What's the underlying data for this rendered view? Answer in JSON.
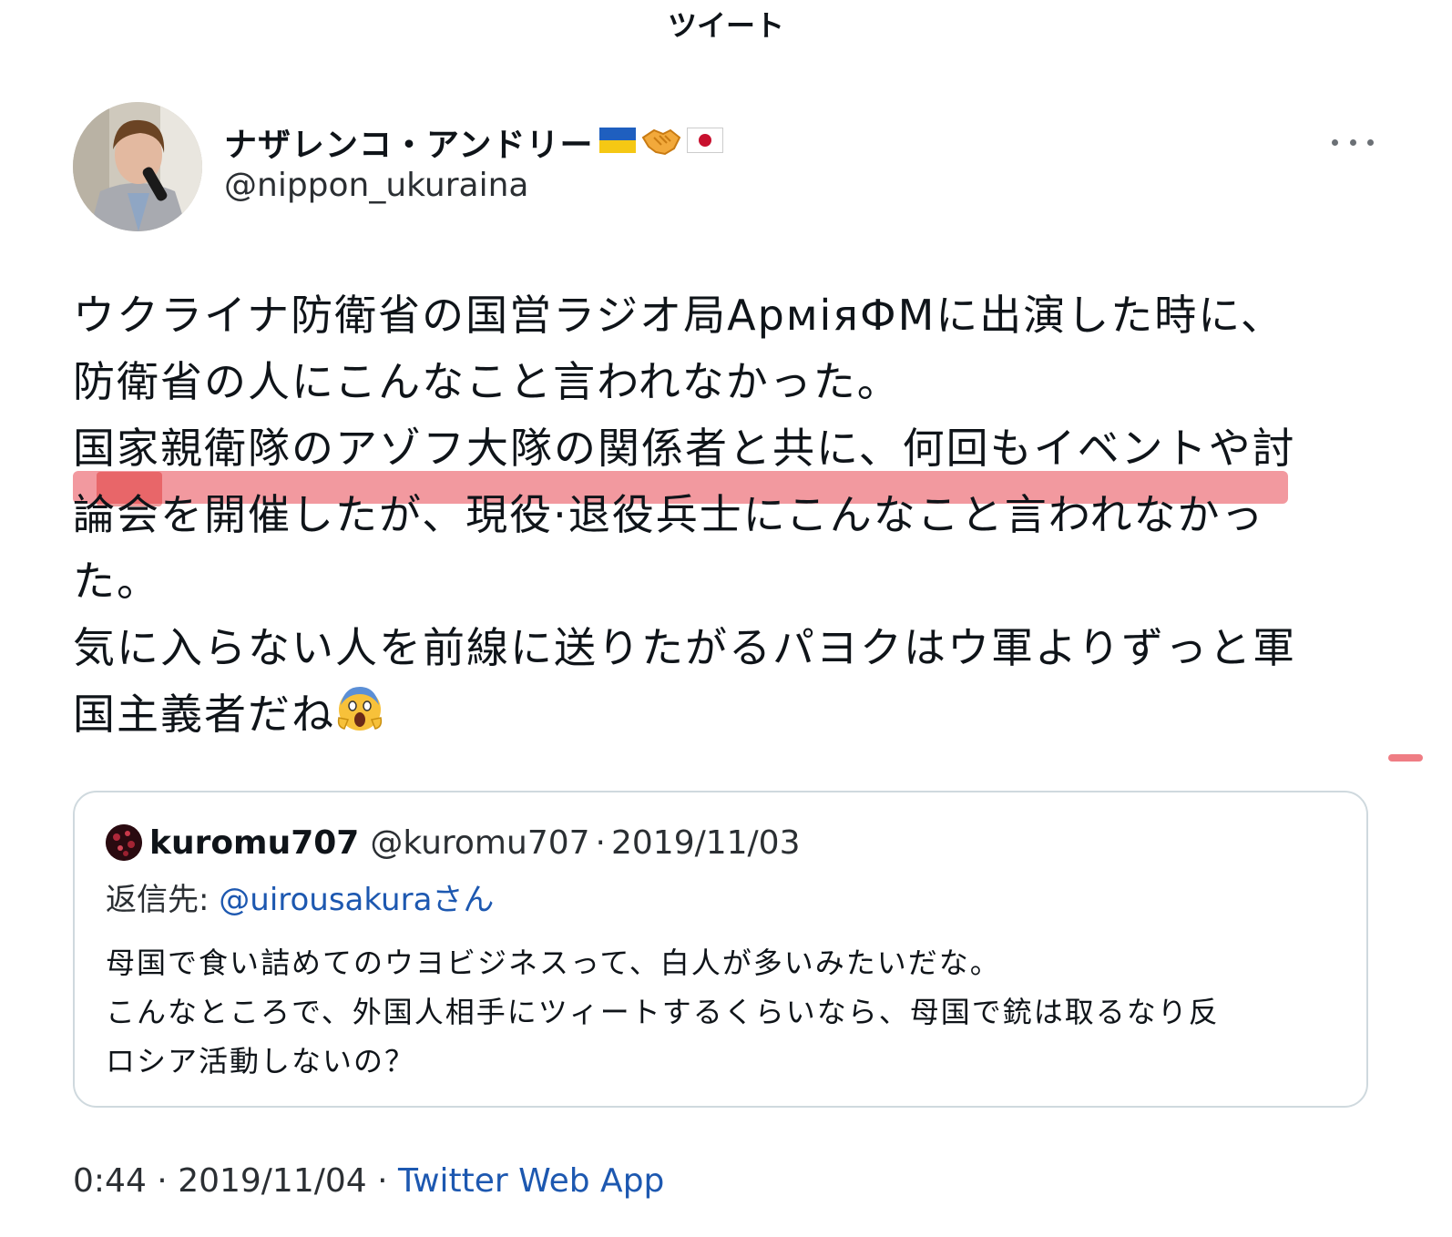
{
  "header": {
    "title": "ツイート"
  },
  "author": {
    "name": "ナザレンコ・アンドリー",
    "handle": "@nippon_ukuraina",
    "name_icons": [
      "ukraine-flag-icon",
      "handshake-icon",
      "japan-flag-icon"
    ]
  },
  "tweet": {
    "lines": [
      "ウクライナ防衛省の国営ラジオ局АрміяФМに出演した時に、",
      "防衛省の人にこんなこと言われなかった。",
      "国家親衛隊のアゾフ大隊の関係者と共に、何回もイベントや討",
      "論会を開催したが、現役·退役兵士にこんなこと言われなかっ",
      "た。",
      "気に入らない人を前線に送りたがるパヨクはウ軍よりずっと軍",
      "国主義者だね"
    ],
    "trailing_emoji": "screaming-face-icon"
  },
  "quote": {
    "name": "kuromu707",
    "handle": "@kuromu707",
    "separator": "·",
    "date": "2019/11/03",
    "reply_prefix": "返信先: ",
    "reply_handle": "@uirousakuraさん",
    "lines": [
      "母国で食い詰めてのウヨビジネスって、白人が多いみたいだな。",
      "こんなところで、外国人相手にツィートするくらいなら、母国で銃は取るなり反",
      "ロシア活動しないの？"
    ]
  },
  "meta": {
    "time": "0:44",
    "separator": " · ",
    "date": "2019/11/04",
    "separator2": " · ",
    "source": "Twitter Web App"
  },
  "colors": {
    "link": "#1d58b0",
    "highlight": "#e84650",
    "text": "#0f1419"
  }
}
